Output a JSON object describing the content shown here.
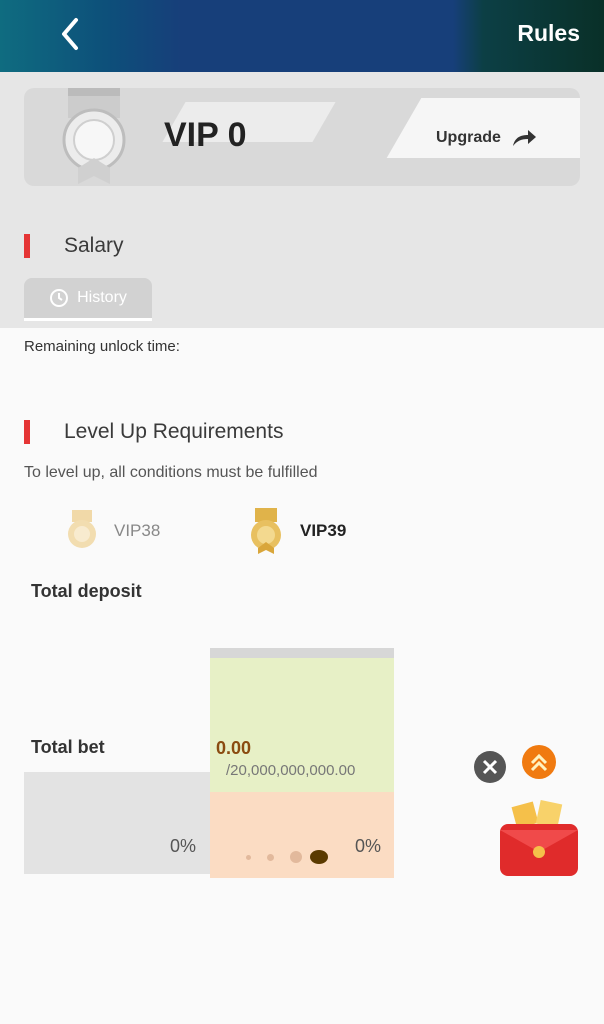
{
  "header": {
    "rules_label": "Rules"
  },
  "vip_card": {
    "title": "VIP 0",
    "upgrade_label": "Upgrade"
  },
  "salary": {
    "title": "Salary",
    "history_label": "History",
    "remaining_label": "Remaining unlock time:"
  },
  "level_up": {
    "title": "Level Up Requirements",
    "subtitle": "To level up, all conditions must be fulfilled",
    "from_level": "VIP38",
    "to_level": "VIP39",
    "deposit": {
      "label": "Total deposit"
    },
    "bet": {
      "label": "Total bet",
      "current": "0.00",
      "target": "/20,000,000,000.00",
      "left_percent": "0%",
      "right_percent": "0%"
    }
  },
  "colors": {
    "accent_red": "#e53535",
    "header_blue": "#173f7a",
    "bet_green": "#e7f0c6",
    "bet_orange": "#fbdcc3"
  },
  "icons": [
    "back-arrow-icon",
    "share-arrow-icon",
    "clock-icon",
    "vip-medal-icon",
    "close-icon",
    "double-chevron-up-icon",
    "red-envelope-icon"
  ]
}
